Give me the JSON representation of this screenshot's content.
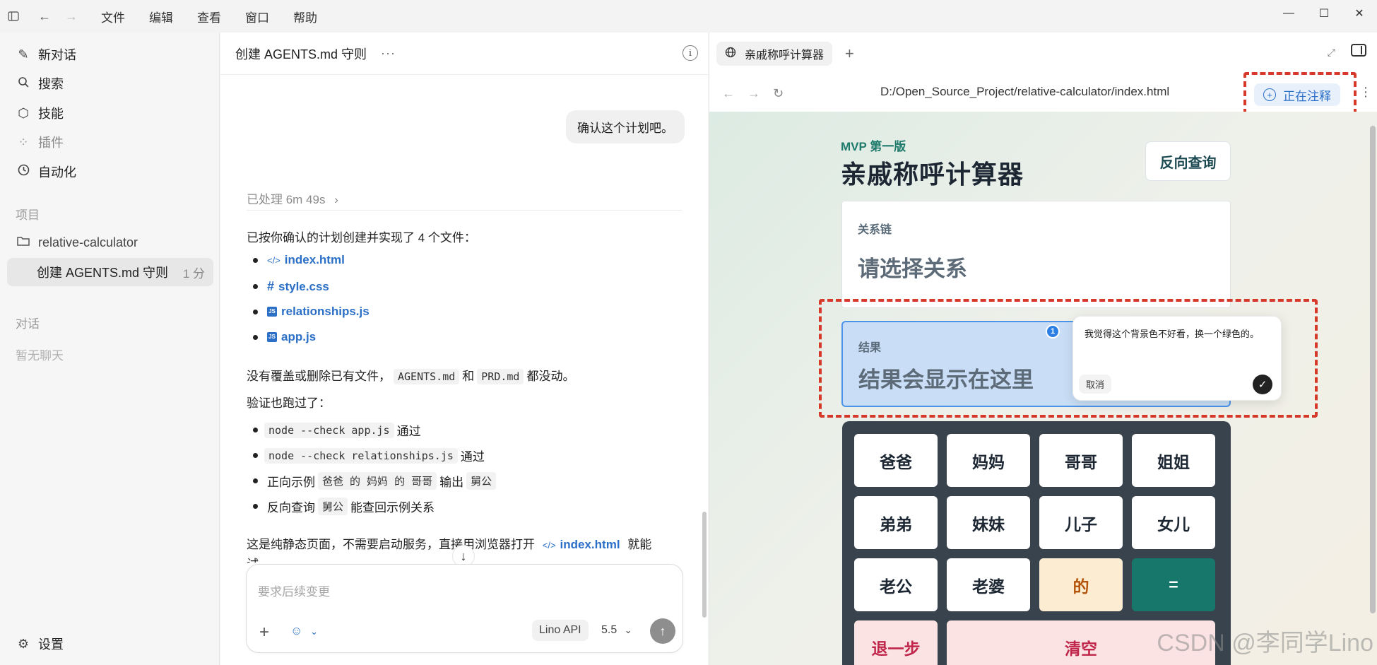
{
  "titlebar": {
    "menus": [
      "文件",
      "编辑",
      "查看",
      "窗口",
      "帮助"
    ]
  },
  "sidebar": {
    "new_chat": "新对话",
    "search": "搜索",
    "skills": "技能",
    "plugins": "插件",
    "automation": "自动化",
    "section_projects": "项目",
    "project_name": "relative-calculator",
    "thread_title": "创建 AGENTS.md 守则",
    "thread_time": "1 分",
    "section_chats": "对话",
    "no_chats": "暂无聊天",
    "settings": "设置"
  },
  "chat": {
    "title": "创建 AGENTS.md 守则",
    "user_message": "确认这个计划吧。",
    "processed": "已处理 6m 49s",
    "intro": "已按你确认的计划创建并实现了 4 个文件：",
    "files": [
      "index.html",
      "style.css",
      "relationships.js",
      "app.js"
    ],
    "no_overwrite_pre": "没有覆盖或删除已有文件，",
    "no_overwrite_code1": "AGENTS.md",
    "no_overwrite_and": "和",
    "no_overwrite_code2": "PRD.md",
    "no_overwrite_post": "都没动。",
    "verify": "验证也跑过了：",
    "checks": [
      {
        "code": "node --check app.js",
        "post": "通过"
      },
      {
        "code": "node --check relationships.js",
        "post": "通过"
      }
    ],
    "example_pre": "正向示例",
    "example_code1": "爸爸 的 妈妈 的 哥哥",
    "example_mid": "输出",
    "example_code2": "舅公",
    "reverse_pre": "反向查询",
    "reverse_code": "舅公",
    "reverse_post": "能查回示例关系",
    "static_pre": "这是纯静态页面，不需要启动服务，直接用浏览器打开",
    "static_link": "index.html",
    "static_post": "就能",
    "static_cut": "试",
    "composer_placeholder": "要求后续变更",
    "api_label": "Lino API",
    "model_label": "5.5"
  },
  "browser": {
    "tab_title": "亲戚称呼计算器",
    "url": "D:/Open_Source_Project/relative-calculator/index.html",
    "annotate_label": "正在注释"
  },
  "page": {
    "eyebrow": "MVP 第一版",
    "title": "亲戚称呼计算器",
    "reverse_button": "反向查询",
    "chain_label": "关系链",
    "chain_value": "请选择关系",
    "result_label": "结果",
    "result_value": "结果会显示在这里",
    "pin_number": "1",
    "comment_text": "我觉得这个背景色不好看，换一个绿色的。",
    "comment_cancel": "取消",
    "keys": {
      "k1": "爸爸",
      "k2": "妈妈",
      "k3": "哥哥",
      "k4": "姐姐",
      "k5": "弟弟",
      "k6": "妹妹",
      "k7": "儿子",
      "k8": "女儿",
      "k9": "老公",
      "k10": "老婆",
      "k11": "的",
      "k12": "=",
      "undo": "退一步",
      "clear": "清空"
    }
  },
  "watermark": "CSDN @李同学Lino"
}
